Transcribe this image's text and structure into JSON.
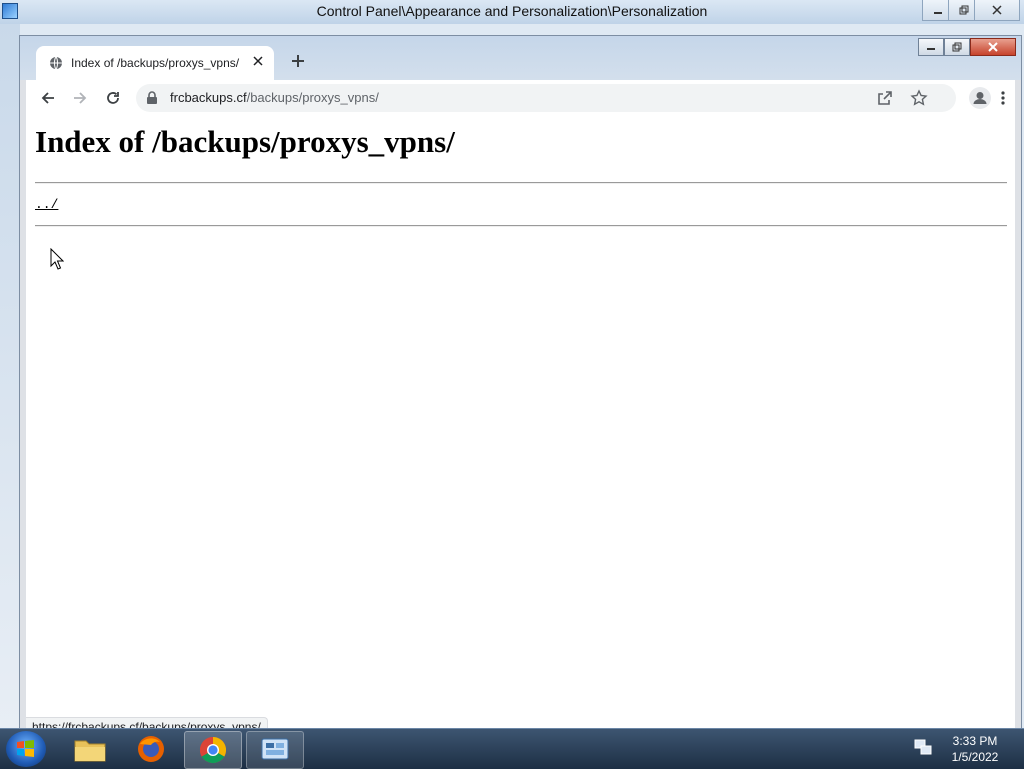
{
  "control_panel": {
    "title": "Control Panel\\Appearance and Personalization\\Personalization"
  },
  "browser": {
    "tab": {
      "title": "Index of /backups/proxys_vpns/",
      "close_icon": "close-icon",
      "favicon": "globe-icon"
    },
    "new_tab_icon": "plus-icon",
    "address_bar": {
      "domain": "frcbackups.cf",
      "path": "/backups/proxys_vpns/"
    },
    "toolbar_icons": [
      "back-arrow-icon",
      "forward-arrow-icon",
      "reload-icon",
      "lock-icon",
      "share-icon",
      "star-icon",
      "profile-icon",
      "kebab-menu-icon"
    ],
    "status_url": "https://frcbackups.cf/backups/proxys_vpns/"
  },
  "page": {
    "heading": "Index of /backups/proxys_vpns/",
    "entries": [
      {
        "label": "../"
      }
    ]
  },
  "taskbar": {
    "items": [
      "windows-explorer",
      "firefox",
      "chrome",
      "control-panel"
    ],
    "clock_time": "3:33 PM",
    "clock_date": "1/5/2022"
  }
}
